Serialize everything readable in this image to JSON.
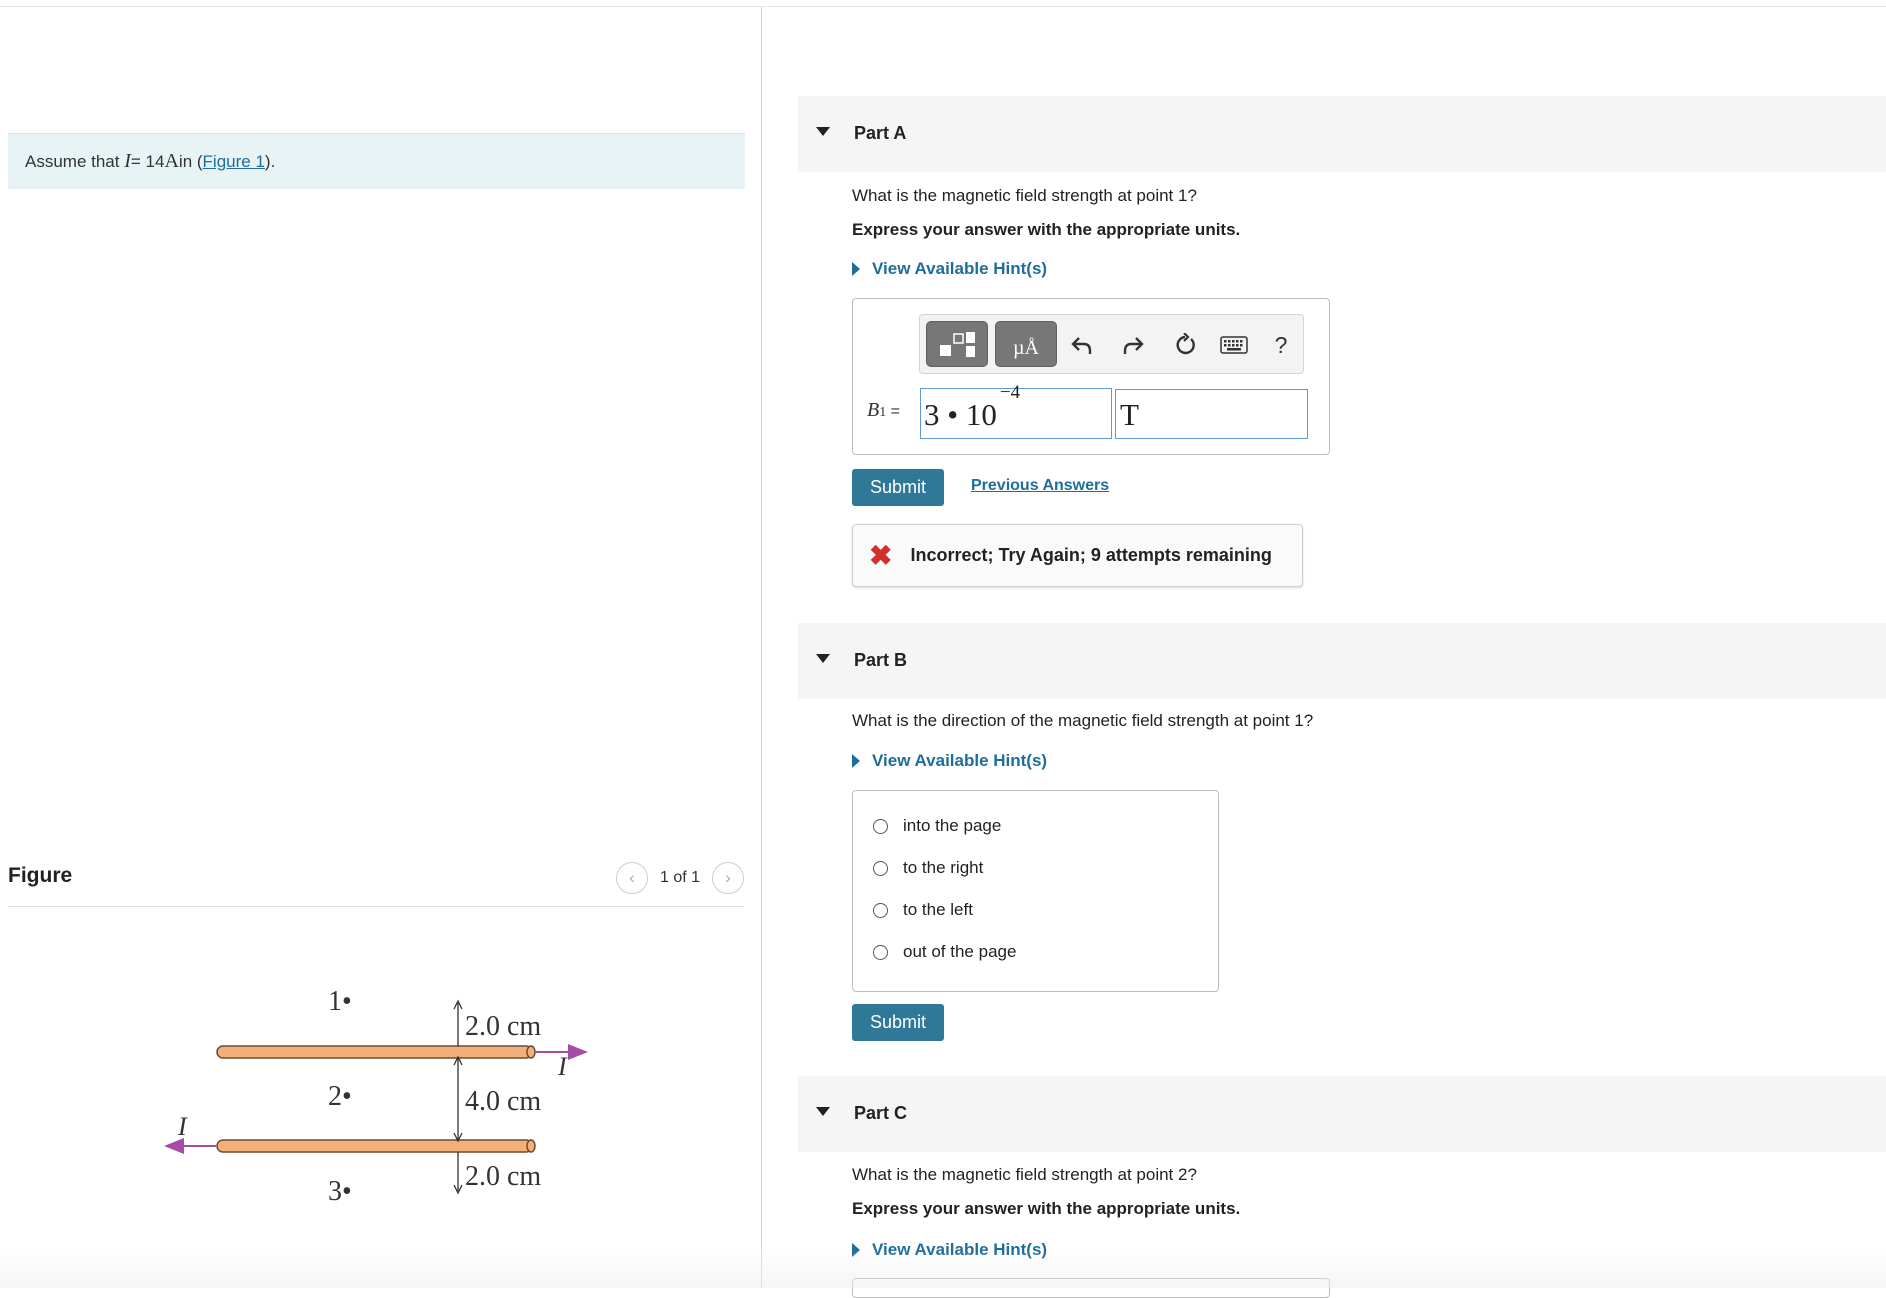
{
  "left": {
    "prompt": {
      "prefix": "Assume that ",
      "var": "I",
      "equals": " = 14 ",
      "unit": "A",
      "in": " in (",
      "link": "Figure 1",
      "suffix": ")."
    },
    "figure": {
      "title": "Figure",
      "pager_text": "1 of 1",
      "prev_icon": "chevron-left-icon",
      "next_icon": "chevron-right-icon",
      "labels": {
        "p1": "1•",
        "p2": "2•",
        "p3": "3•",
        "d1": "2.0 cm",
        "d2": "4.0 cm",
        "d3": "2.0 cm",
        "current_top": "I",
        "current_bottom": "I"
      },
      "colors": {
        "wire": "#f4b07a",
        "wire_edge": "#6b4a2e",
        "arrow": "#a64ca6"
      }
    }
  },
  "partA": {
    "title": "Part A",
    "question": "What is the magnetic field strength at point 1?",
    "instruction": "Express your answer with the appropriate units.",
    "hint": "View Available Hint(s)",
    "toolbar": {
      "templates_icon": "templates-icon",
      "units_label": "µÅ",
      "undo_icon": "undo-icon",
      "redo_icon": "redo-icon",
      "reset_icon": "reset-icon",
      "keyboard_icon": "keyboard-icon",
      "help_label": "?"
    },
    "var_label": "B",
    "var_sub": "1",
    "eq_sign": " =",
    "value_base": "3 • 10",
    "value_exp": "−4",
    "unit_value": "T",
    "submit": "Submit",
    "previous_answers": "Previous Answers",
    "feedback": "Incorrect; Try Again; 9 attempts remaining"
  },
  "partB": {
    "title": "Part B",
    "question": "What is the direction of the magnetic field strength at point 1?",
    "hint": "View Available Hint(s)",
    "options": [
      "into the page",
      "to the right",
      "to the left",
      "out of the page"
    ],
    "submit": "Submit"
  },
  "partC": {
    "title": "Part C",
    "question": "What is the magnetic field strength at point 2?",
    "instruction": "Express your answer with the appropriate units.",
    "hint": "View Available Hint(s)"
  },
  "colors": {
    "accent": "#2f7898",
    "link": "#1f6d99",
    "error": "#d0312d",
    "prompt_bg": "#e7f3f5"
  }
}
